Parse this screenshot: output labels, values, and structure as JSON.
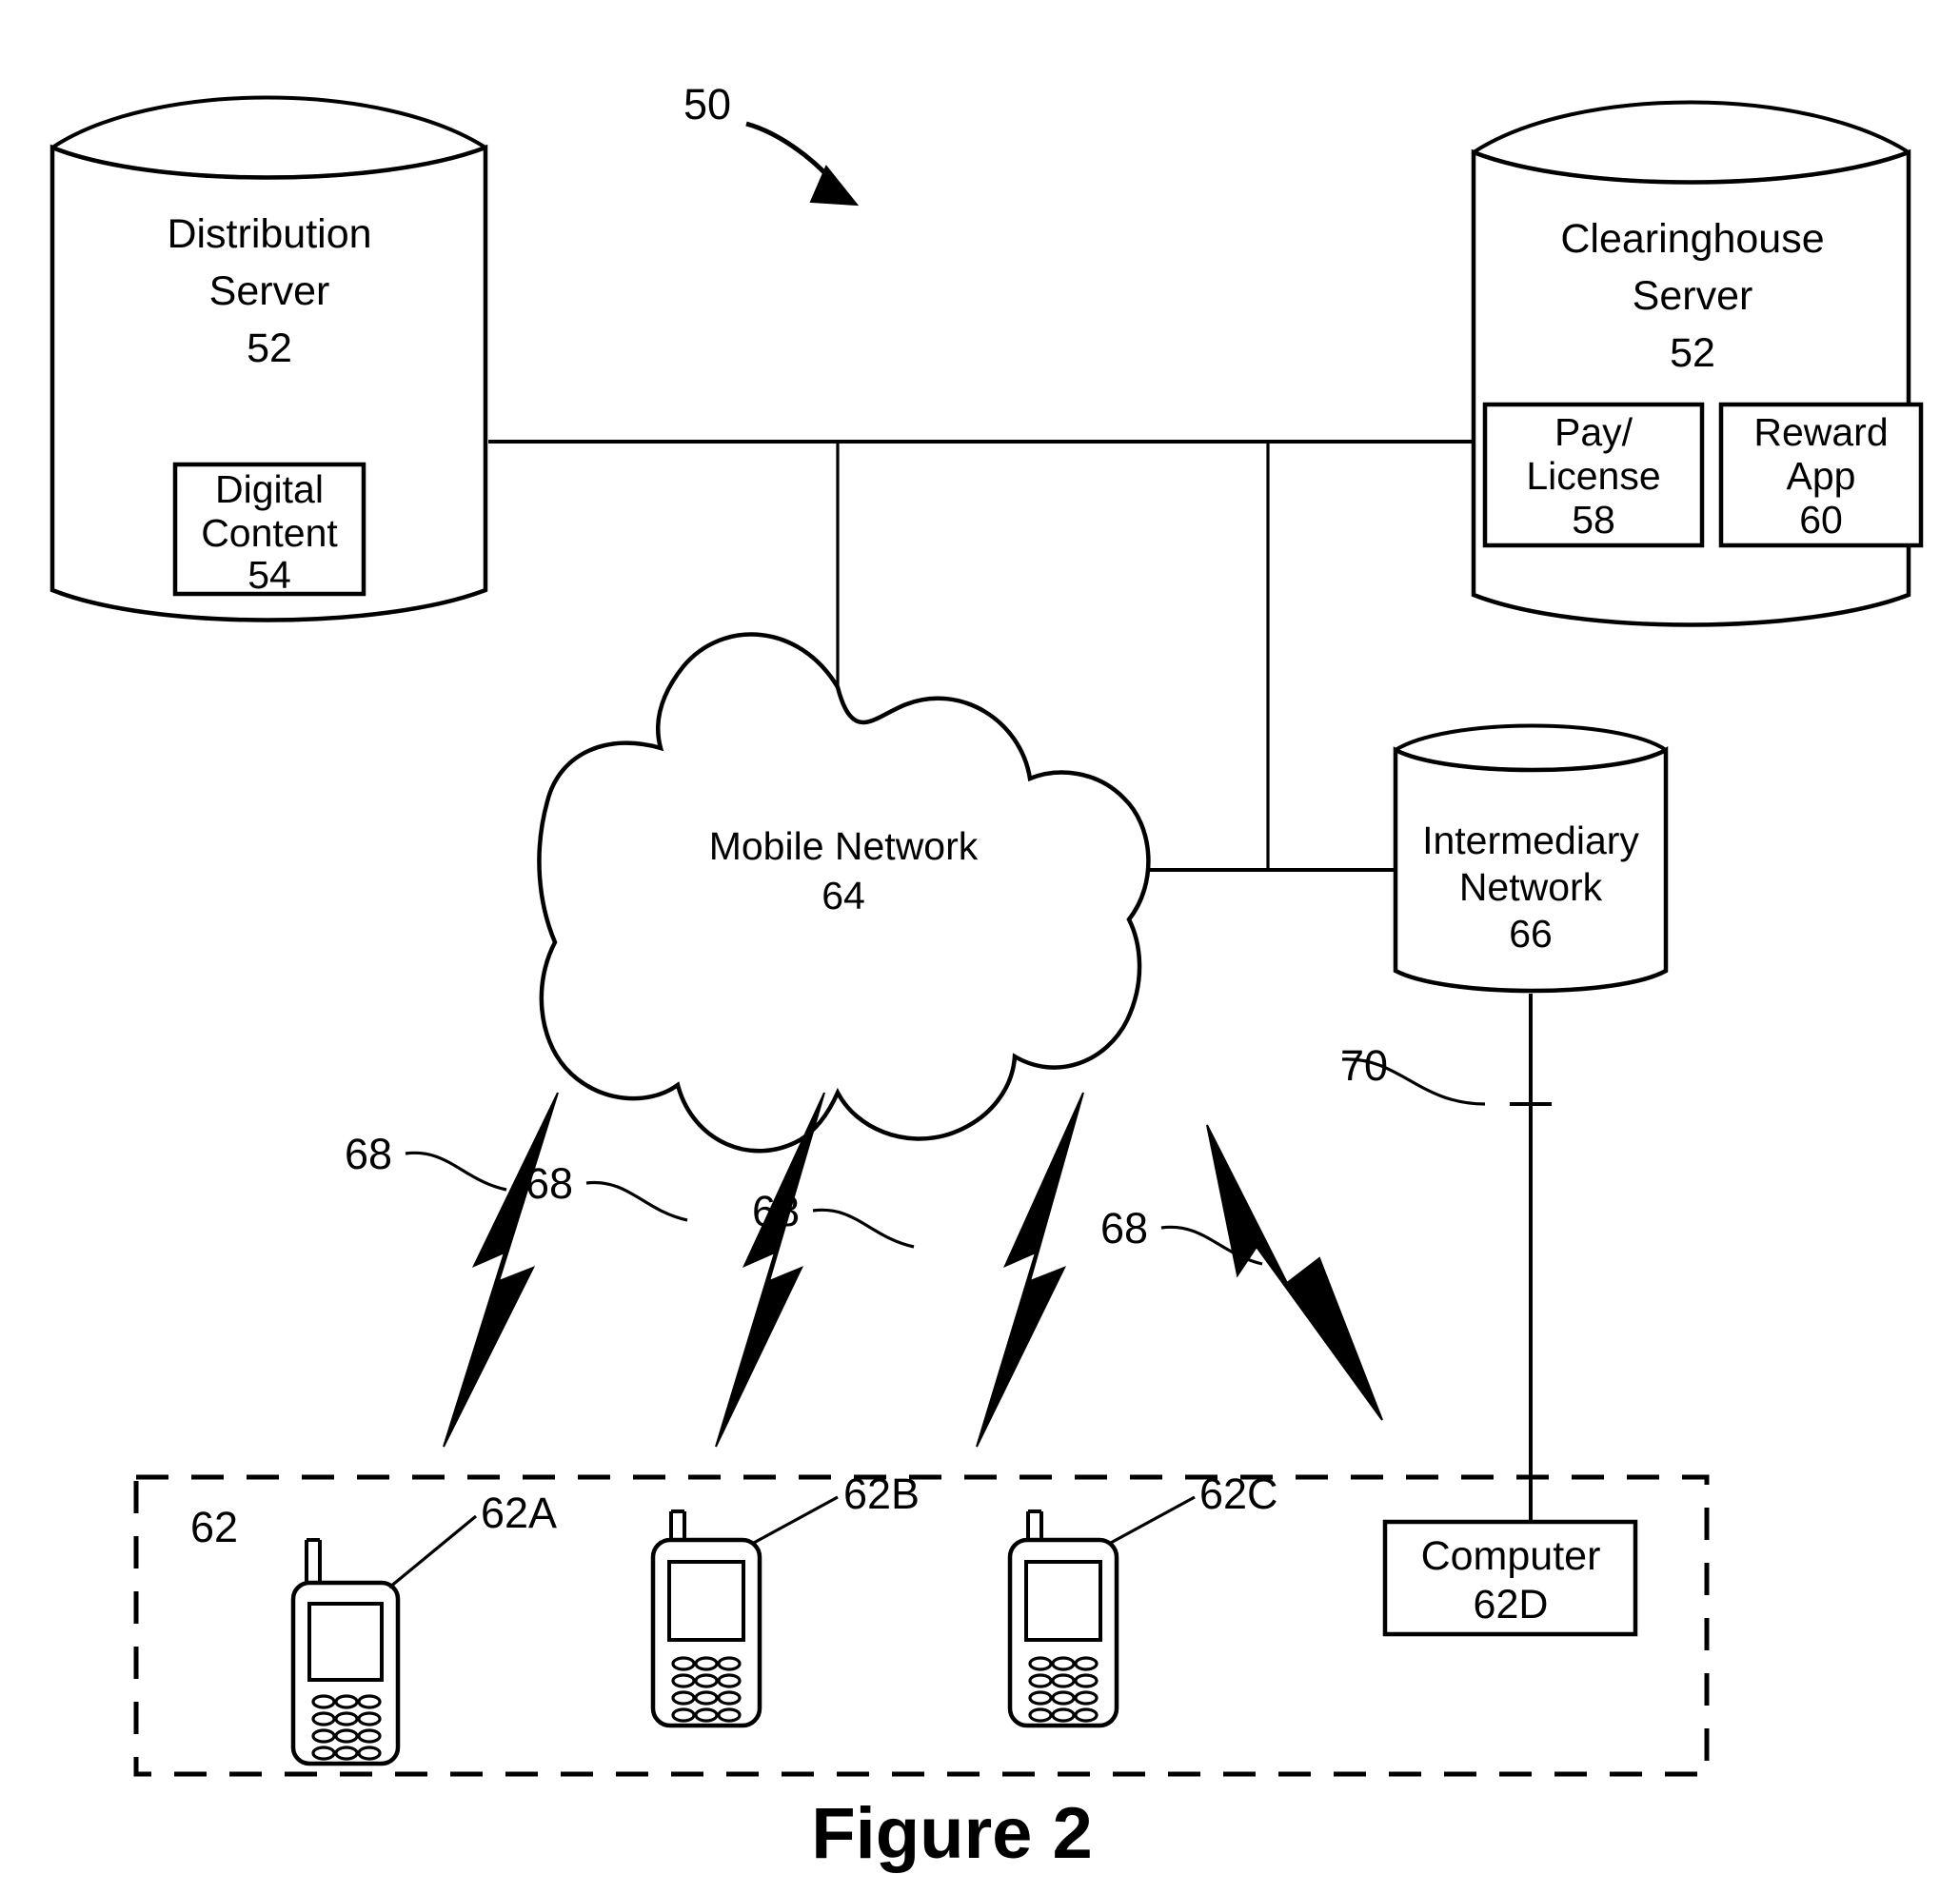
{
  "figure": {
    "caption": "Figure 2",
    "system_ref": "50"
  },
  "nodes": {
    "distribution_server": {
      "name": "distribution-server",
      "line1": "Distribution",
      "line2": "Server",
      "ref": "52",
      "inner_box": {
        "line1": "Digital",
        "line2": "Content",
        "ref": "54"
      }
    },
    "clearinghouse_server": {
      "name": "clearinghouse-server",
      "line1": "Clearinghouse",
      "line2": "Server",
      "ref": "52",
      "inner_boxes": [
        {
          "line1": "Pay/",
          "line2": "License",
          "ref": "58"
        },
        {
          "line1": "Reward",
          "line2": "App",
          "ref": "60"
        }
      ]
    },
    "mobile_network": {
      "name": "mobile-network-cloud",
      "label": "Mobile Network",
      "ref": "64"
    },
    "intermediary_network": {
      "name": "intermediary-network",
      "line1": "Intermediary",
      "line2": "Network",
      "ref": "66"
    },
    "computer": {
      "name": "computer-node",
      "label": "Computer",
      "ref": "62D"
    }
  },
  "connections": {
    "intermediary_link_ref": "70"
  },
  "wireless_links": {
    "ref": "68",
    "labels": [
      "68",
      "68",
      "68",
      "68"
    ]
  },
  "device_group": {
    "group_ref": "62",
    "devices": [
      {
        "name": "mobile-device-a",
        "ref": "62A"
      },
      {
        "name": "mobile-device-b",
        "ref": "62B"
      },
      {
        "name": "mobile-device-c",
        "ref": "62C"
      }
    ]
  },
  "colors": {
    "ink": "#000000",
    "paper": "#ffffff"
  }
}
